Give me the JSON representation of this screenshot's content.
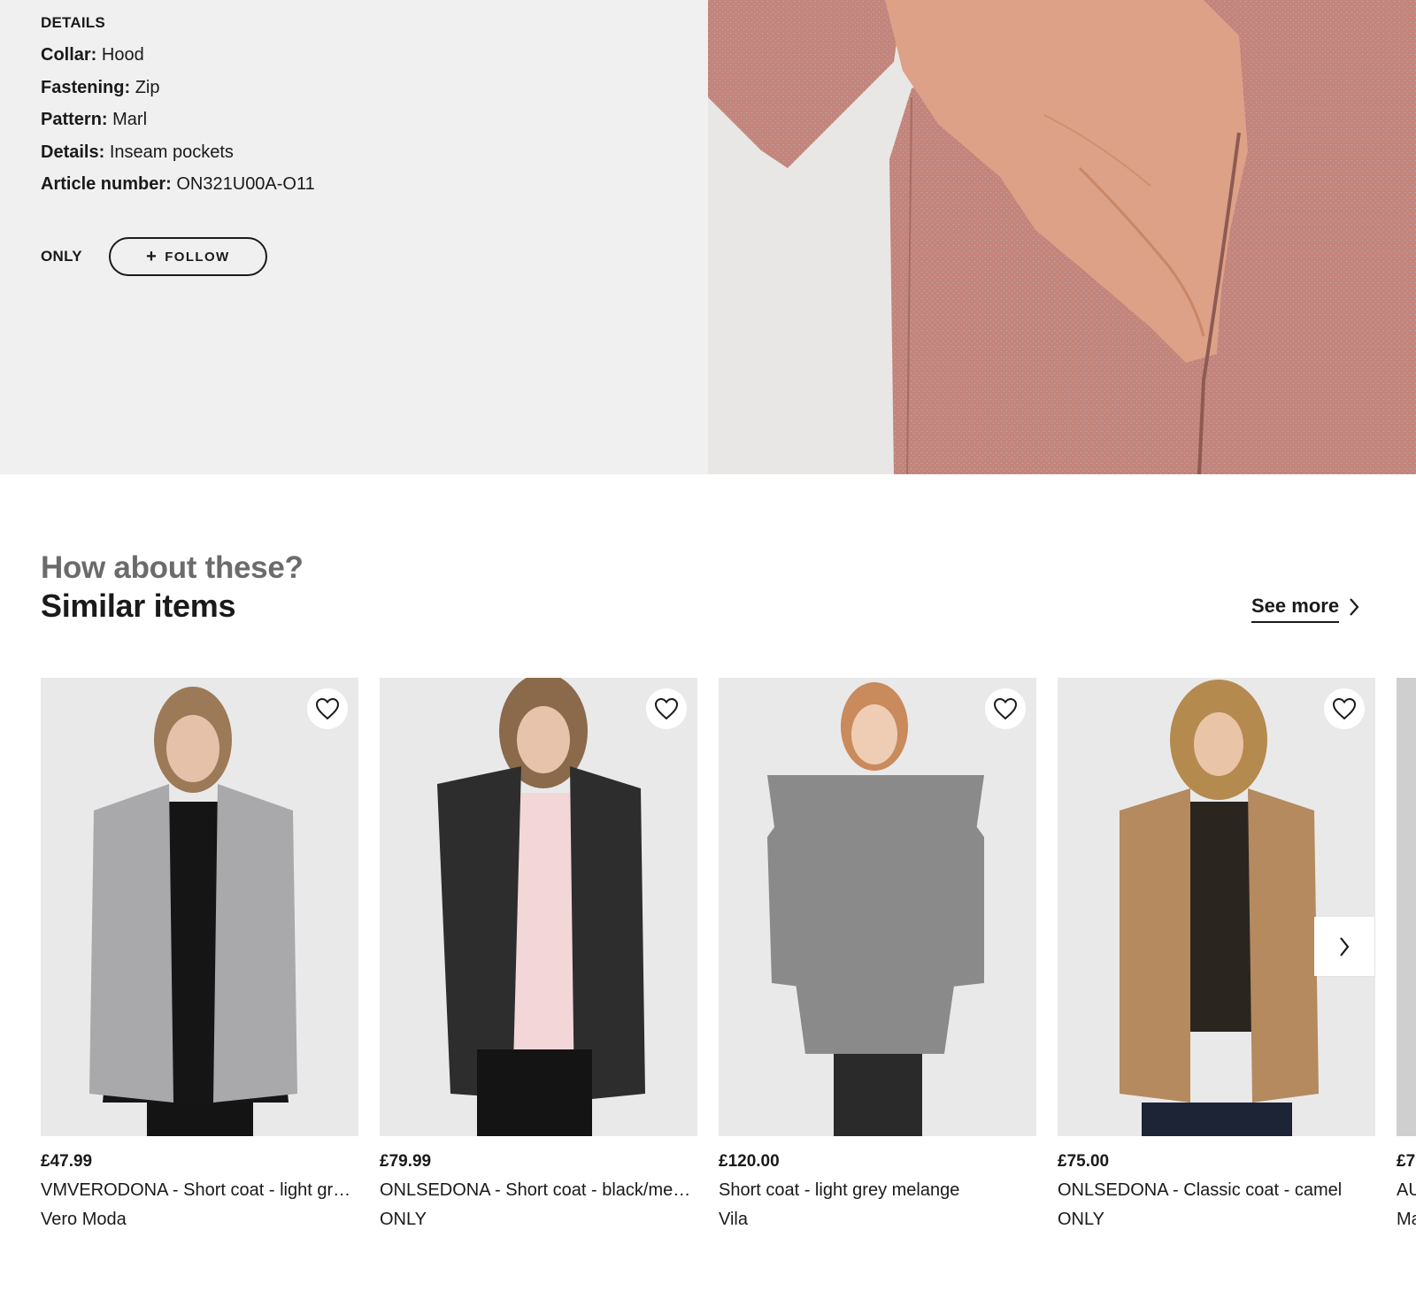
{
  "details": {
    "heading": "DETAILS",
    "attributes": [
      {
        "key": "Collar:",
        "value": "Hood"
      },
      {
        "key": "Fastening:",
        "value": "Zip"
      },
      {
        "key": "Pattern:",
        "value": "Marl"
      },
      {
        "key": "Details:",
        "value": "Inseam pockets"
      },
      {
        "key": "Article number:",
        "value": "ON321U00A-O11"
      }
    ],
    "brand": "ONLY",
    "follow_label": "FOLLOW",
    "follow_icon": "plus-icon"
  },
  "closeup_photo": {
    "subject": "product-closeup-pink-marl-coat-pocket",
    "color": "#c2847b"
  },
  "similar": {
    "eyebrow": "How about these?",
    "title": "Similar items",
    "see_more": "See more",
    "products": [
      {
        "price": "£47.99",
        "name": "VMVERODONA - Short coat - light gr…",
        "brand": "Vero Moda",
        "coat_color": "#a9a9ab",
        "inner_color": "#151515",
        "hair_color": "#9c7a58"
      },
      {
        "price": "£79.99",
        "name": "ONLSEDONA - Short coat - black/me…",
        "brand": "ONLY",
        "coat_color": "#2d2d2d",
        "inner_color": "#f3d6d8",
        "hair_color": "#8a6a4b"
      },
      {
        "price": "£120.00",
        "name": "Short coat - light grey melange",
        "brand": "Vila",
        "coat_color": "#8a8a8a",
        "inner_color": "#8a8a8a",
        "hair_color": "#c98a5c"
      },
      {
        "price": "£75.00",
        "name": "ONLSEDONA - Classic coat - camel",
        "brand": "ONLY",
        "coat_color": "#b48a5e",
        "inner_color": "#2b2520",
        "hair_color": "#b48a4e"
      },
      {
        "price": "£7",
        "name": "AU",
        "brand": "Ma",
        "coat_color": "#cfcfcf",
        "inner_color": "#cfcfcf",
        "hair_color": "#cfcfcf"
      }
    ]
  },
  "icons": {
    "wishlist": "heart-outline-icon",
    "next": "chevron-right-icon"
  }
}
